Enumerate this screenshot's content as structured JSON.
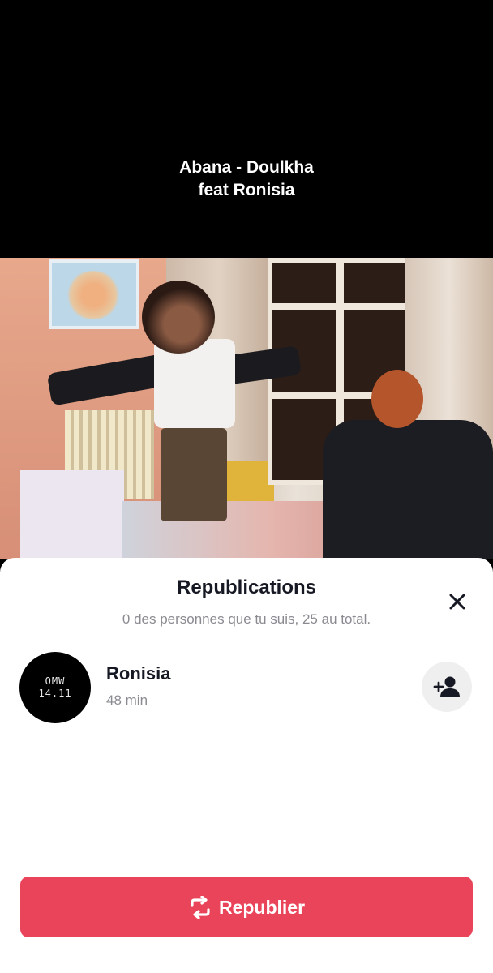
{
  "video": {
    "caption_line1": "Abana - Doulkha",
    "caption_line2": "feat Ronisia"
  },
  "sheet": {
    "title": "Republications",
    "subtitle": "0 des personnes que tu suis, 25 au total.",
    "close_icon": "close-icon"
  },
  "users": [
    {
      "name": "Ronisia",
      "time": "48 min",
      "avatar_line1": "OMW",
      "avatar_line2": "14.11",
      "follow_icon": "add-user-icon"
    }
  ],
  "action": {
    "label": "Republier",
    "icon": "repost-icon",
    "color": "#ea445a"
  }
}
